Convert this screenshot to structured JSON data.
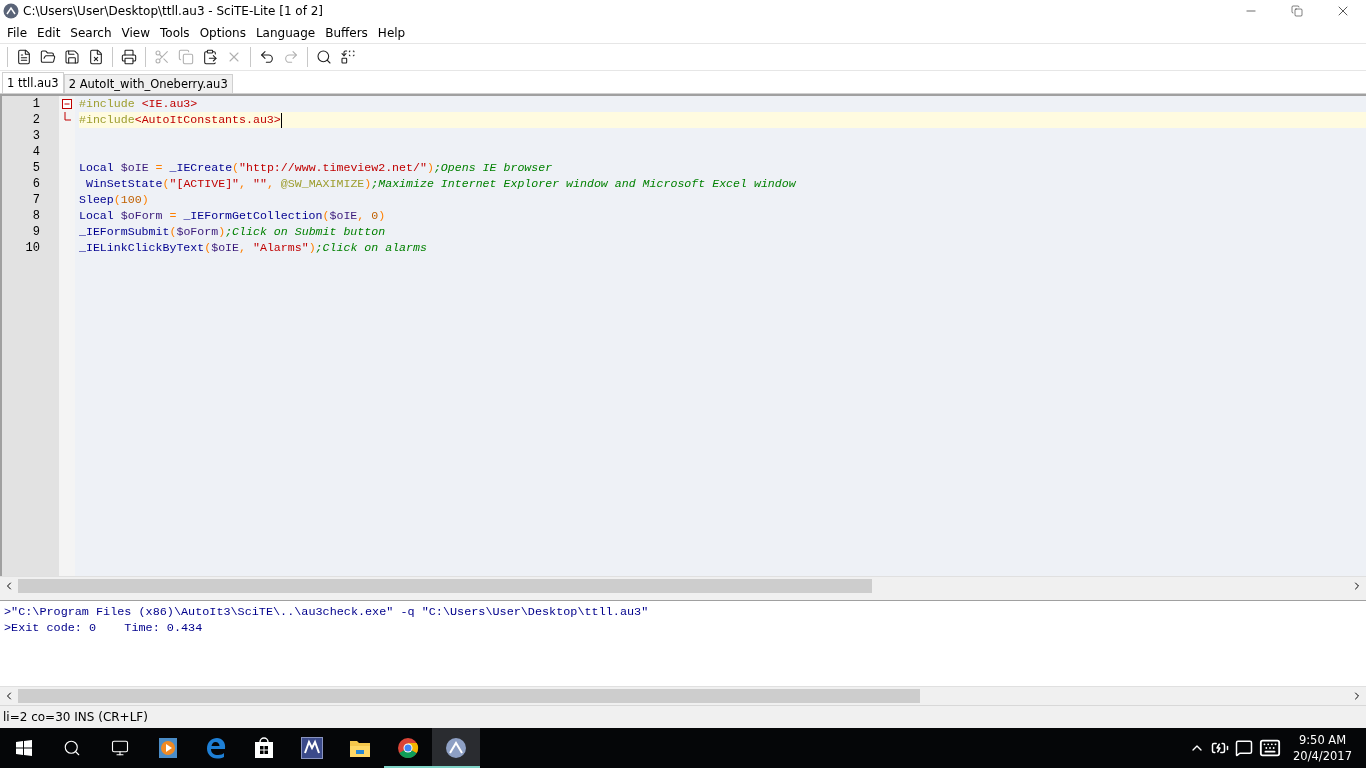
{
  "window": {
    "title": "C:\\Users\\User\\Desktop\\ttll.au3 - SciTE-Lite [1 of 2]"
  },
  "menu": [
    "File",
    "Edit",
    "Search",
    "View",
    "Tools",
    "Options",
    "Language",
    "Buffers",
    "Help"
  ],
  "toolbar": [
    {
      "kind": "new",
      "disabled": false
    },
    {
      "kind": "open",
      "disabled": false
    },
    {
      "kind": "save",
      "disabled": false
    },
    {
      "kind": "close",
      "disabled": false
    },
    {
      "kind": "sep"
    },
    {
      "kind": "print",
      "disabled": false
    },
    {
      "kind": "sep"
    },
    {
      "kind": "cut",
      "disabled": true
    },
    {
      "kind": "copy",
      "disabled": true
    },
    {
      "kind": "paste",
      "disabled": false
    },
    {
      "kind": "delete",
      "disabled": true
    },
    {
      "kind": "sep"
    },
    {
      "kind": "undo",
      "disabled": false
    },
    {
      "kind": "redo",
      "disabled": true
    },
    {
      "kind": "sep"
    },
    {
      "kind": "find",
      "disabled": false
    },
    {
      "kind": "replace",
      "disabled": false
    }
  ],
  "tabs": [
    {
      "label": "1 ttll.au3",
      "selected": true
    },
    {
      "label": "2 AutoIt_with_Oneberry.au3",
      "selected": false
    }
  ],
  "editor": {
    "lines": [
      {
        "number": "1",
        "current": false,
        "fold_header": true,
        "expanded": true,
        "tokens": [
          {
            "kind": "preproc",
            "text": "#include"
          },
          {
            "kind": "include",
            "text": " <IE.au3>"
          }
        ]
      },
      {
        "number": "2",
        "current": true,
        "fold_end": true,
        "tokens": [
          {
            "kind": "preproc",
            "text": "#include"
          },
          {
            "kind": "include",
            "text": "<AutoItConstants.au3>"
          }
        ]
      },
      {
        "number": "3",
        "current": false
      },
      {
        "number": "4",
        "current": false
      },
      {
        "number": "5",
        "current": false,
        "tokens": [
          {
            "kind": "keyword",
            "text": "Local"
          },
          {
            "kind": "variable",
            "text": " $oIE"
          },
          {
            "kind": "operator",
            "text": " ="
          },
          {
            "kind": "function",
            "text": " _IECreate"
          },
          {
            "kind": "operator",
            "text": "("
          },
          {
            "kind": "string",
            "text": "\"http://www.timeview2.net/\""
          },
          {
            "kind": "operator",
            "text": ")"
          },
          {
            "kind": "comment",
            "text": ";Opens IE browser"
          }
        ]
      },
      {
        "number": "6",
        "current": false,
        "tokens": [
          {
            "kind": "function",
            "text": " WinSetState"
          },
          {
            "kind": "operator",
            "text": "("
          },
          {
            "kind": "string",
            "text": "\"[ACTIVE]\""
          },
          {
            "kind": "operator",
            "text": ","
          },
          {
            "kind": "string",
            "text": " \"\""
          },
          {
            "kind": "operator",
            "text": ","
          },
          {
            "kind": "macro",
            "text": " @SW_MAXIMIZE"
          },
          {
            "kind": "operator",
            "text": ")"
          },
          {
            "kind": "comment",
            "text": ";Maximize Internet Explorer window and Microsoft Excel window"
          }
        ]
      },
      {
        "number": "7",
        "current": false,
        "tokens": [
          {
            "kind": "function",
            "text": "Sleep"
          },
          {
            "kind": "operator",
            "text": "("
          },
          {
            "kind": "number",
            "text": "100"
          },
          {
            "kind": "operator",
            "text": ")"
          }
        ]
      },
      {
        "number": "8",
        "current": false,
        "tokens": [
          {
            "kind": "keyword",
            "text": "Local"
          },
          {
            "kind": "variable",
            "text": " $oForm"
          },
          {
            "kind": "operator",
            "text": " ="
          },
          {
            "kind": "function",
            "text": " _IEFormGetCollection"
          },
          {
            "kind": "operator",
            "text": "("
          },
          {
            "kind": "variable",
            "text": "$oIE"
          },
          {
            "kind": "operator",
            "text": ","
          },
          {
            "kind": "number",
            "text": " 0"
          },
          {
            "kind": "operator",
            "text": ")"
          }
        ]
      },
      {
        "number": "9",
        "current": false,
        "tokens": [
          {
            "kind": "function",
            "text": "_IEFormSubmit"
          },
          {
            "kind": "operator",
            "text": "("
          },
          {
            "kind": "variable",
            "text": "$oForm"
          },
          {
            "kind": "operator",
            "text": ")"
          },
          {
            "kind": "comment",
            "text": ";Click on Submit button"
          }
        ]
      },
      {
        "number": "10",
        "current": false,
        "tokens": [
          {
            "kind": "function",
            "text": "_IELinkClickByText"
          },
          {
            "kind": "operator",
            "text": "("
          },
          {
            "kind": "variable",
            "text": "$oIE"
          },
          {
            "kind": "operator",
            "text": ","
          },
          {
            "kind": "string",
            "text": " \"Alarms\""
          },
          {
            "kind": "operator",
            "text": ")"
          },
          {
            "kind": "comment",
            "text": ";Click on alarms"
          }
        ]
      }
    ]
  },
  "output": {
    "lines": [
      ">\"C:\\Program Files (x86)\\AutoIt3\\SciTE\\..\\au3check.exe\" -q \"C:\\Users\\User\\Desktop\\ttll.au3\"",
      ">Exit code: 0    Time: 0.434"
    ]
  },
  "status_bar": "li=2 co=30 INS (CR+LF)",
  "taskbar": {
    "apps": [
      {
        "kind": "media",
        "running": false,
        "selected": false
      },
      {
        "kind": "edge",
        "running": false,
        "selected": false
      },
      {
        "kind": "store",
        "running": false,
        "selected": false
      },
      {
        "kind": "mxcc",
        "running": false,
        "selected": false
      },
      {
        "kind": "explorer",
        "running": false,
        "selected": false
      },
      {
        "kind": "chrome",
        "running": true,
        "selected": false
      },
      {
        "kind": "autoit",
        "running": true,
        "selected": true
      }
    ],
    "time": "9:50 AM",
    "date": "20/4/2017"
  }
}
